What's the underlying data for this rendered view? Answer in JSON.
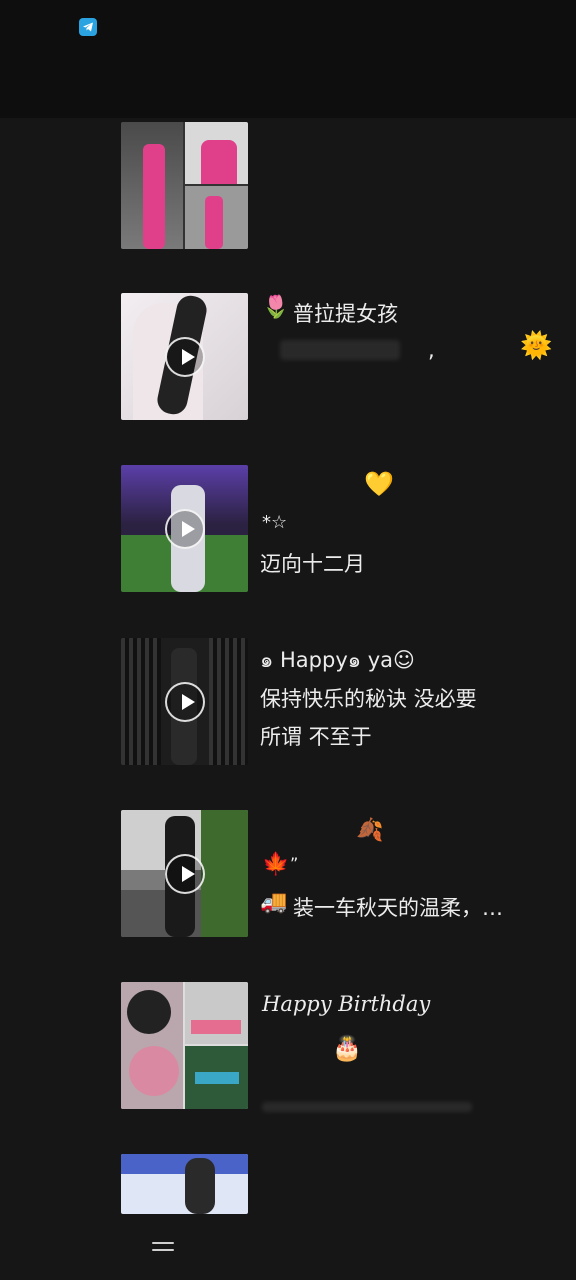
{
  "status_bar": {
    "icon": "telegram-icon"
  },
  "posts": [
    {
      "id": 1,
      "media": "image-grid",
      "lines": []
    },
    {
      "id": 2,
      "media": "video",
      "lines": [
        "普拉提女孩",
        ","
      ],
      "emojis": [
        "tulip",
        "sun-with-face"
      ]
    },
    {
      "id": 3,
      "media": "video",
      "lines": [
        "*☆",
        "迈向十二月"
      ],
      "emojis": [
        "yellow-heart"
      ]
    },
    {
      "id": 4,
      "media": "video",
      "lines": [
        "๑ Happy๑ ya☺",
        "保持快乐的秘诀 没必要",
        "所谓 不至于"
      ]
    },
    {
      "id": 5,
      "media": "video",
      "lines": [
        "”",
        "装一车秋天的温柔，…"
      ],
      "emojis": [
        "fallen-leaf",
        "maple-leaf",
        "truck"
      ]
    },
    {
      "id": 6,
      "media": "image-grid",
      "lines": [
        "Happy Birthday"
      ],
      "emojis": [
        "birthday-cake"
      ]
    },
    {
      "id": 7,
      "media": "video",
      "lines": []
    }
  ],
  "colors": {
    "background": "#161616",
    "topbar": "#0e0e0e",
    "pink": "#e0408a"
  }
}
